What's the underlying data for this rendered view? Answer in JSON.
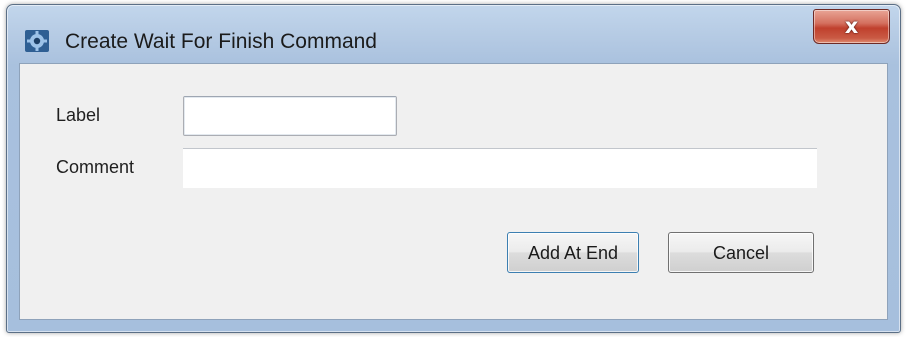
{
  "window": {
    "title": "Create Wait For Finish Command",
    "close_glyph": "x",
    "icon": "app-gear-icon"
  },
  "form": {
    "label_caption": "Label",
    "label_value": "",
    "comment_caption": "Comment",
    "comment_value": ""
  },
  "buttons": {
    "add_at_end": "Add At End",
    "cancel": "Cancel"
  },
  "colors": {
    "titlebar": "#b6cbe4",
    "close_button": "#c0402d",
    "client_bg": "#f0f0f0",
    "default_button_border": "#3c7fb1"
  }
}
